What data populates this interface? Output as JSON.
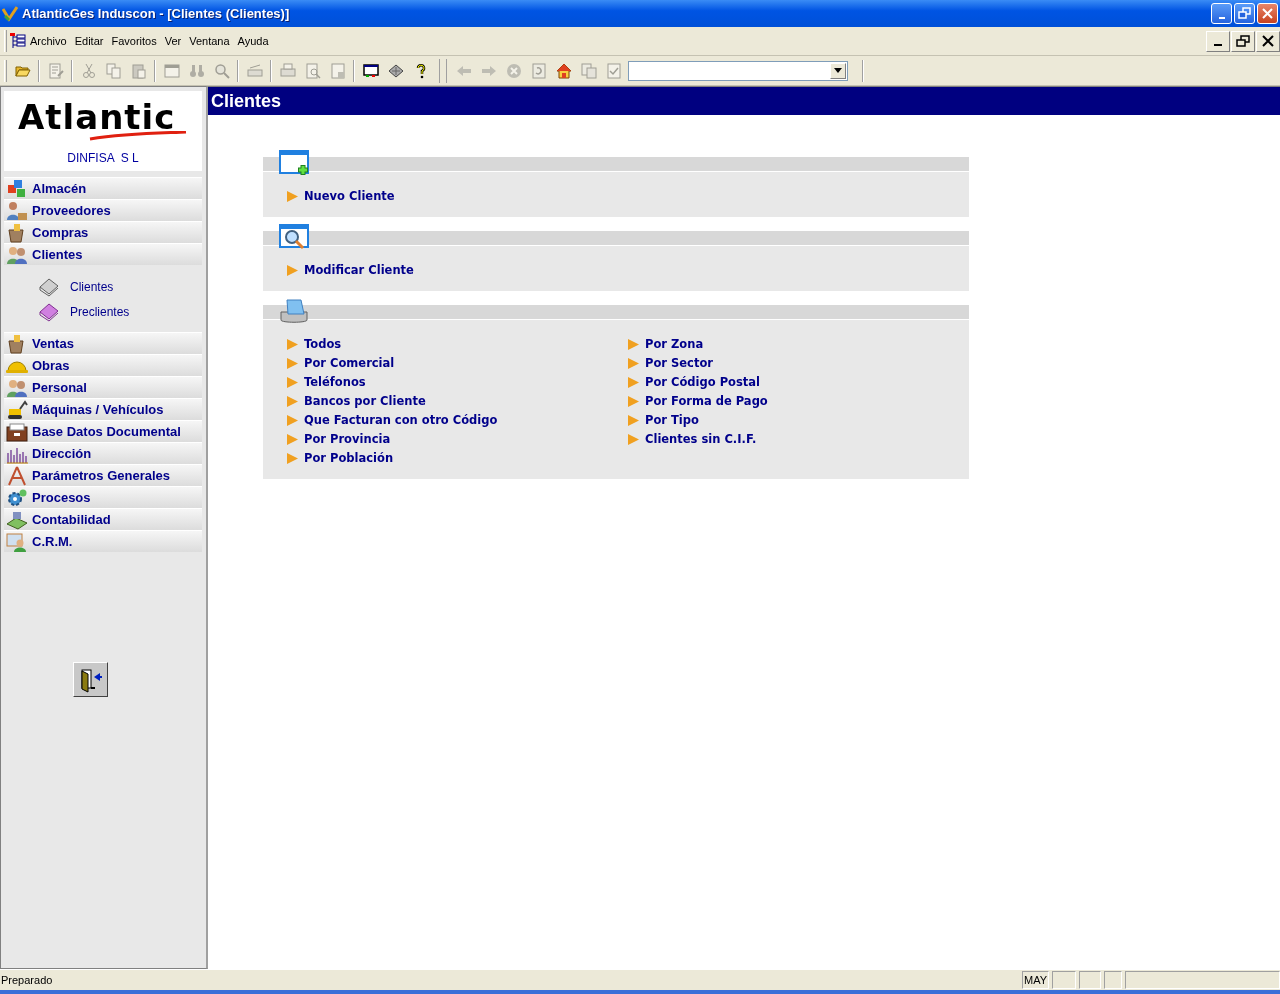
{
  "window": {
    "title": "AtlanticGes Induscon - [Clientes (Clientes)]"
  },
  "menu": [
    "Archivo",
    "Editar",
    "Favoritos",
    "Ver",
    "Ventana",
    "Ayuda"
  ],
  "toolbar": [
    {
      "kind": "open-folder",
      "disabled": false
    },
    {
      "kind": "sep"
    },
    {
      "kind": "document-edit",
      "disabled": true
    },
    {
      "kind": "sep"
    },
    {
      "kind": "scissors",
      "disabled": true
    },
    {
      "kind": "copy",
      "disabled": true
    },
    {
      "kind": "paste",
      "disabled": true
    },
    {
      "kind": "sep"
    },
    {
      "kind": "window",
      "disabled": true
    },
    {
      "kind": "binoculars",
      "disabled": true
    },
    {
      "kind": "search",
      "disabled": true
    },
    {
      "kind": "sep"
    },
    {
      "kind": "scanner",
      "disabled": true
    },
    {
      "kind": "sep"
    },
    {
      "kind": "printer",
      "disabled": true
    },
    {
      "kind": "print-preview",
      "disabled": true
    },
    {
      "kind": "page",
      "disabled": true
    },
    {
      "kind": "sep"
    },
    {
      "kind": "monitor",
      "disabled": false
    },
    {
      "kind": "tag",
      "disabled": false
    },
    {
      "kind": "help",
      "disabled": false
    },
    {
      "kind": "grip"
    },
    {
      "kind": "back",
      "disabled": true
    },
    {
      "kind": "forward",
      "disabled": true
    },
    {
      "kind": "stop",
      "disabled": true
    },
    {
      "kind": "refresh",
      "disabled": true
    },
    {
      "kind": "home",
      "disabled": false
    },
    {
      "kind": "sync",
      "disabled": true
    },
    {
      "kind": "check-page",
      "disabled": true
    }
  ],
  "sidebar": {
    "logo": "Atlantic",
    "company": "DINFISA  S L",
    "items": [
      {
        "label": "Almacén"
      },
      {
        "label": "Proveedores"
      },
      {
        "label": "Compras"
      },
      {
        "label": "Clientes",
        "children": [
          {
            "label": "Clientes"
          },
          {
            "label": "Preclientes"
          }
        ]
      },
      {
        "label": "Ventas"
      },
      {
        "label": "Obras"
      },
      {
        "label": "Personal"
      },
      {
        "label": "Máquinas / Vehículos"
      },
      {
        "label": "Base Datos Documental"
      },
      {
        "label": "Dirección"
      },
      {
        "label": "Parámetros Generales"
      },
      {
        "label": "Procesos"
      },
      {
        "label": "Contabilidad"
      },
      {
        "label": "C.R.M."
      }
    ]
  },
  "content": {
    "title": "Clientes",
    "sections": [
      {
        "columns": [
          [
            "Nuevo Cliente"
          ]
        ]
      },
      {
        "columns": [
          [
            "Modificar Cliente"
          ]
        ]
      },
      {
        "columns": [
          [
            "Todos",
            "Por Comercial",
            "Teléfonos",
            "Bancos por Cliente",
            "Que Facturan con otro Código",
            "Por Provincia",
            "Por Población"
          ],
          [
            "Por Zona",
            "Por Sector",
            "Por Código Postal",
            "Por Forma de Pago",
            "Por Tipo",
            "Clientes sin C.I.F."
          ]
        ]
      }
    ]
  },
  "status_bar": {
    "message": "Preparado",
    "indicators": [
      "MAY"
    ]
  }
}
